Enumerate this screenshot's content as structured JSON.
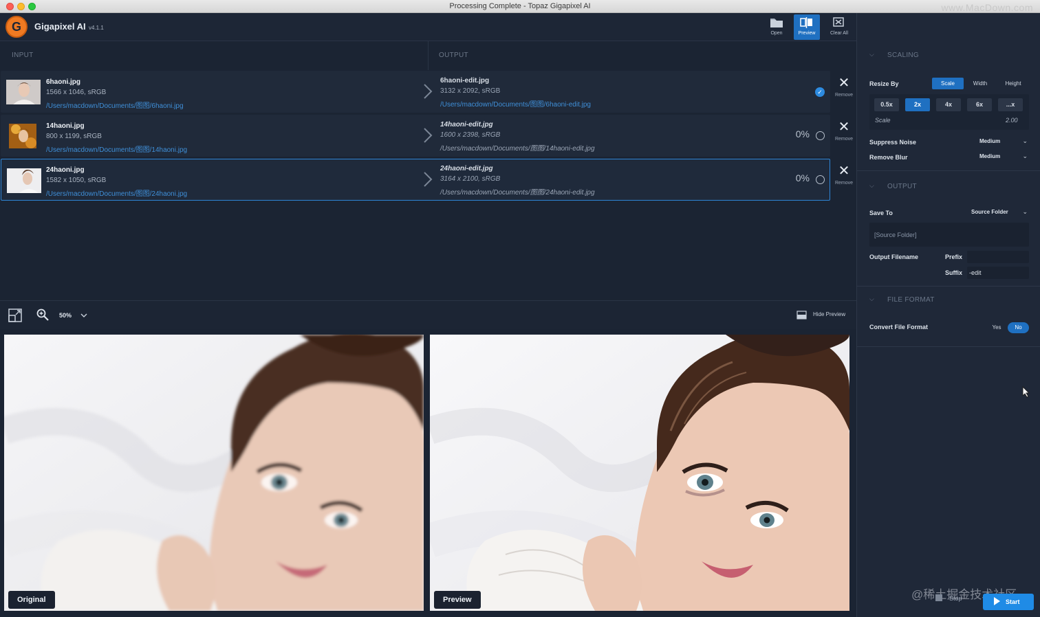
{
  "window": {
    "title": "Processing Complete - Topaz Gigapixel AI",
    "watermark_top": "www.MacDown.com"
  },
  "app": {
    "name": "Gigapixel AI",
    "version": "v4.1.1",
    "logo_letter": "G"
  },
  "toolbar": {
    "open_label": "Open",
    "preview_label": "Preview",
    "clear_all_label": "Clear All"
  },
  "columns": {
    "input": "INPUT",
    "output": "OUTPUT"
  },
  "files": [
    {
      "name": "6haoni.jpg",
      "meta": "1566 x 1046, sRGB",
      "path": "/Users/macdown/Documents/图图/6haoni.jpg",
      "out_name": "6haoni-edit.jpg",
      "out_meta": "3132 x 2092, sRGB",
      "out_path": "/Users/macdown/Documents/图图/6haoni-edit.jpg",
      "status": "done",
      "remove_label": "Remove"
    },
    {
      "name": "14haoni.jpg",
      "meta": "800 x 1199, sRGB",
      "path": "/Users/macdown/Documents/图图/14haoni.jpg",
      "out_name": "14haoni-edit.jpg",
      "out_meta": "1600 x 2398, sRGB",
      "out_path": "/Users/macdown/Documents/图图/14haoni-edit.jpg",
      "progress": "0%",
      "remove_label": "Remove"
    },
    {
      "name": "24haoni.jpg",
      "meta": "1582 x 1050, sRGB",
      "path": "/Users/macdown/Documents/图图/24haoni.jpg",
      "out_name": "24haoni-edit.jpg",
      "out_meta": "3164 x 2100, sRGB",
      "out_path": "/Users/macdown/Documents/图图/24haoni-edit.jpg",
      "progress": "0%",
      "remove_label": "Remove"
    }
  ],
  "preview_bar": {
    "zoom": "50%",
    "hide_preview": "Hide Preview"
  },
  "preview": {
    "original_label": "Original",
    "preview_label": "Preview"
  },
  "scaling": {
    "header": "SCALING",
    "resize_by_label": "Resize By",
    "resize_options": [
      "Scale",
      "Width",
      "Height"
    ],
    "resize_selected": "Scale",
    "scale_options": [
      "0.5x",
      "2x",
      "4x",
      "6x",
      "...x"
    ],
    "scale_selected": "2x",
    "scale_label": "Scale",
    "scale_value": "2.00",
    "suppress_noise_label": "Suppress Noise",
    "suppress_noise_value": "Medium",
    "remove_blur_label": "Remove Blur",
    "remove_blur_value": "Medium"
  },
  "output": {
    "header": "OUTPUT",
    "save_to_label": "Save To",
    "save_to_value": "Source Folder",
    "folder_field": "[Source Folder]",
    "output_filename_label": "Output Filename",
    "prefix_label": "Prefix",
    "prefix_value": "",
    "suffix_label": "Suffix",
    "suffix_value": "-edit"
  },
  "file_format": {
    "header": "FILE FORMAT",
    "convert_label": "Convert File Format",
    "yes_label": "Yes",
    "no_label": "No",
    "selected": "No"
  },
  "actions": {
    "stop_label": "Stop",
    "start_label": "Start"
  },
  "watermark_bottom": "@稀土掘金技术社区",
  "colors": {
    "accent": "#1f70c1",
    "link": "#3f8fd8",
    "background": "#1b2433"
  }
}
